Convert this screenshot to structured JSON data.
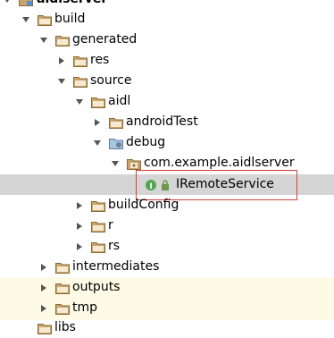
{
  "colors": {
    "folder": "#c8a46a",
    "selection": "#d5d5d5",
    "highlight_border": "#d43f3a",
    "interface_badge": "#52a652",
    "yellow_band": "#fdfbe6"
  },
  "tree": {
    "module_label": "aidlserver",
    "build_label": "build",
    "generated_label": "generated",
    "res_label": "res",
    "source_label": "source",
    "aidl_label": "aidl",
    "androidtest_label": "androidTest",
    "debug_label": "debug",
    "package_label": "com.example.aidlserver",
    "iremoteservice_label": "IRemoteService",
    "buildconfig_label": "buildConfig",
    "r_label": "r",
    "rs_label": "rs",
    "intermediates_label": "intermediates",
    "outputs_label": "outputs",
    "tmp_label": "tmp",
    "libs_label": "libs"
  }
}
